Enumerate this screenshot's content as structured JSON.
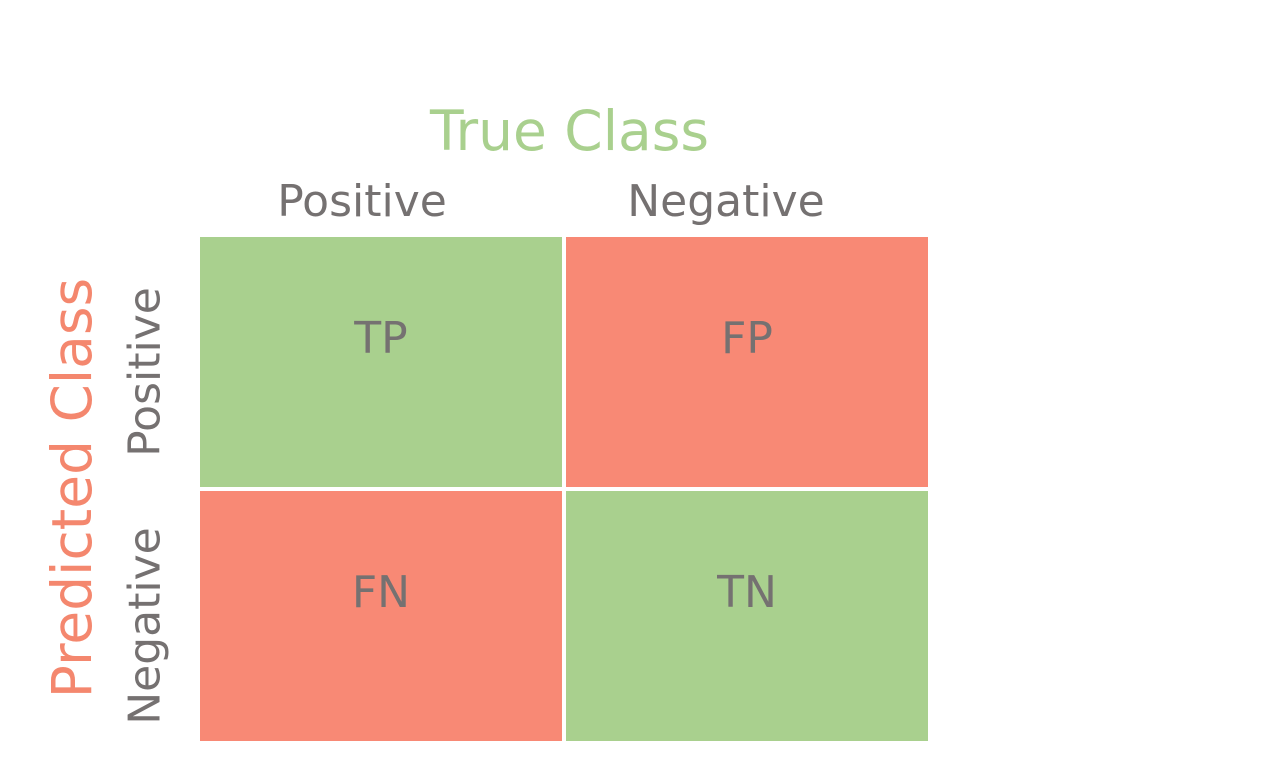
{
  "titles": {
    "true_class": "True Class",
    "predicted_class": "Predicted Class"
  },
  "columns": [
    "Positive",
    "Negative"
  ],
  "rows": [
    "Positive",
    "Negative"
  ],
  "cells": [
    [
      "TP",
      "FP"
    ],
    [
      "FN",
      "TN"
    ]
  ],
  "colors": {
    "correct": "#a9d08e",
    "incorrect": "#f88975",
    "true_class_title": "#a9d08e",
    "predicted_class_title": "#f4876e",
    "label_text": "#757171"
  }
}
